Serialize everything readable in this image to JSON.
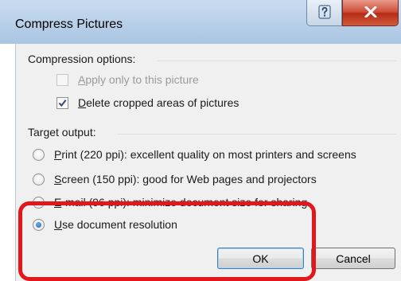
{
  "window": {
    "title": "Compress Pictures",
    "help_icon": "question-mark-icon",
    "close_icon": "close-x-icon"
  },
  "compression_options": {
    "label": "Compression options:",
    "apply_only": {
      "mnemonic": "A",
      "rest": "pply only to this picture",
      "checked": false,
      "enabled": false
    },
    "delete_cropped": {
      "mnemonic": "D",
      "rest": "elete cropped areas of pictures",
      "checked": true,
      "enabled": true
    }
  },
  "target_output": {
    "label": "Target output:",
    "options": [
      {
        "mnemonic": "P",
        "rest": "rint (220 ppi): excellent quality on most printers and screens",
        "selected": false
      },
      {
        "mnemonic": "S",
        "rest": "creen (150 ppi): good for Web pages and projectors",
        "selected": false
      },
      {
        "mnemonic": "E",
        "rest": "-mail (96 ppi): minimize document size for sharing",
        "selected": false
      },
      {
        "mnemonic": "U",
        "rest": "se document resolution",
        "selected": true
      }
    ]
  },
  "buttons": {
    "ok": "OK",
    "cancel": "Cancel"
  },
  "colors": {
    "highlight": "#e3161c",
    "close_button": "#c8432c",
    "title_bar": "#b9d1ea"
  }
}
